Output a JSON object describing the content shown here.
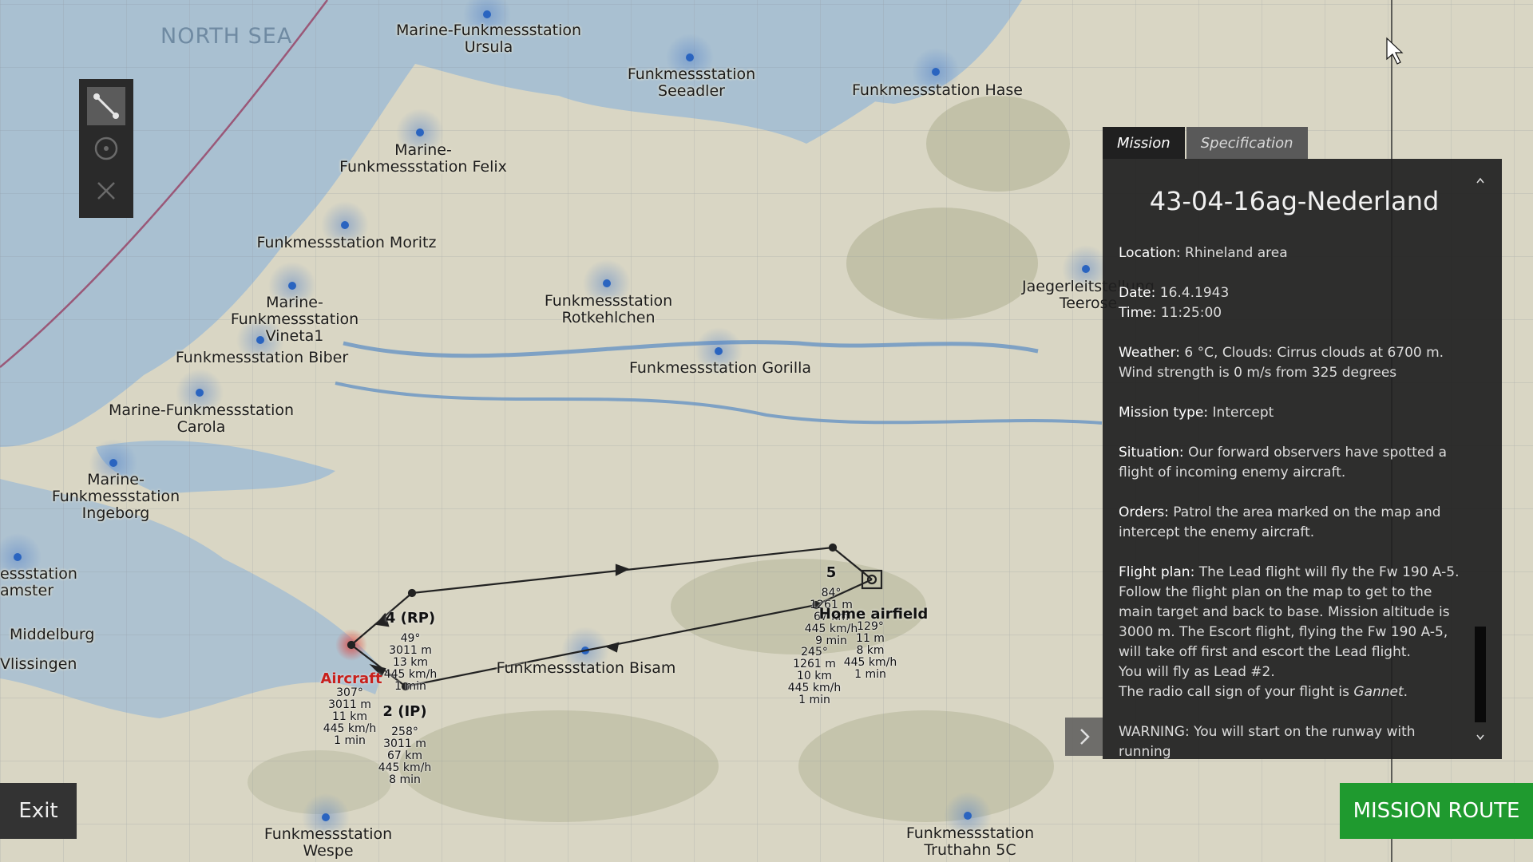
{
  "map": {
    "sea_label": "NORTH SEA",
    "stations": [
      {
        "name": "Marine-Funkmessstation\nUrsula"
      },
      {
        "name": "Funkmessstation\nSeeadler"
      },
      {
        "name": "Funkmessstation Hase"
      },
      {
        "name": "Marine-\nFunkmessstation Felix"
      },
      {
        "name": "Funkmessstation Moritz"
      },
      {
        "name": "Marine-\nFunkmessstation\nVineta1"
      },
      {
        "name": "Funkmessstation Biber"
      },
      {
        "name": "Funkmessstation\nRotkehlchen"
      },
      {
        "name": "Funkmessstation Gorilla"
      },
      {
        "name": "Jaegerleitstellung\nTeerose"
      },
      {
        "name": "Marine-Funkmessstation\nCarola"
      },
      {
        "name": "Marine-\nFunkmessstation\nIngeborg"
      },
      {
        "name": "essstation\namster"
      },
      {
        "name": "Funkmessstation Bisam"
      },
      {
        "name": "Funkmessstation\nWespe"
      },
      {
        "name": "Funkmessstation\nTruthahn 5C"
      }
    ],
    "places": [
      "Middelburg",
      "Vlissingen"
    ],
    "route": {
      "aircraft": {
        "label": "Aircraft",
        "info": "307°\n3011 m\n11 km\n445 km/h\n1 min"
      },
      "ip": {
        "label": "2 (IP)",
        "info": "258°\n3011 m\n67 km\n445 km/h\n8 min"
      },
      "rp": {
        "label": "4 (RP)",
        "info": "49°\n3011 m\n13 km\n445 km/h\n1 min"
      },
      "wp5": {
        "label": "5",
        "info": "84°\n1261 m\n67 km\n445 km/h\n9 min"
      },
      "home": {
        "label": "Home airfield",
        "info": "129°\n11 m\n8 km\n445 km/h\n1 min"
      },
      "back": {
        "info": "245°\n1261 m\n10 km\n445 km/h\n1 min"
      }
    }
  },
  "tabs": [
    {
      "label": "Mission"
    },
    {
      "label": "Specification"
    }
  ],
  "mission": {
    "title": "43-04-16ag-Nederland",
    "location_key": "Location:",
    "location": " Rhineland area",
    "date_key": "Date:",
    "date": " 16.4.1943",
    "time_key": "Time:",
    "time": " 11:25:00",
    "weather_key": "Weather:",
    "weather": " 6 °C, Clouds: Cirrus clouds at 6700 m. Wind strength is 0 m/s from 325 degrees",
    "type_key": "Mission type:",
    "type": "  Intercept",
    "situation_key": "Situation:",
    "situation": "  Our forward observers have spotted a flight of incoming enemy aircraft.",
    "orders_key": "Orders:",
    "orders": "  Patrol the area marked on the map and intercept the enemy aircraft.",
    "flightplan_key": "Flight plan:",
    "flightplan": "  The Lead flight will fly the Fw 190 A-5. Follow the flight plan on the map to get to the main target and back to base. Mission altitude is 3000 m. The Escort flight, flying the Fw 190 A-5, will take off first and escort the Lead flight.",
    "lead_line": "You will fly as Lead #2.",
    "callsign_prefix": "The radio call sign of your flight is ",
    "callsign": "Gannet",
    "warning": "WARNING: You will start on the runway with running"
  },
  "buttons": {
    "exit": "Exit",
    "mission_route": "MISSION ROUTE"
  },
  "colors": {
    "accent_green": "#1f9a2f",
    "sea": "#a9c0d1",
    "land": "#d9d6c4",
    "route_red": "#c8201c"
  }
}
